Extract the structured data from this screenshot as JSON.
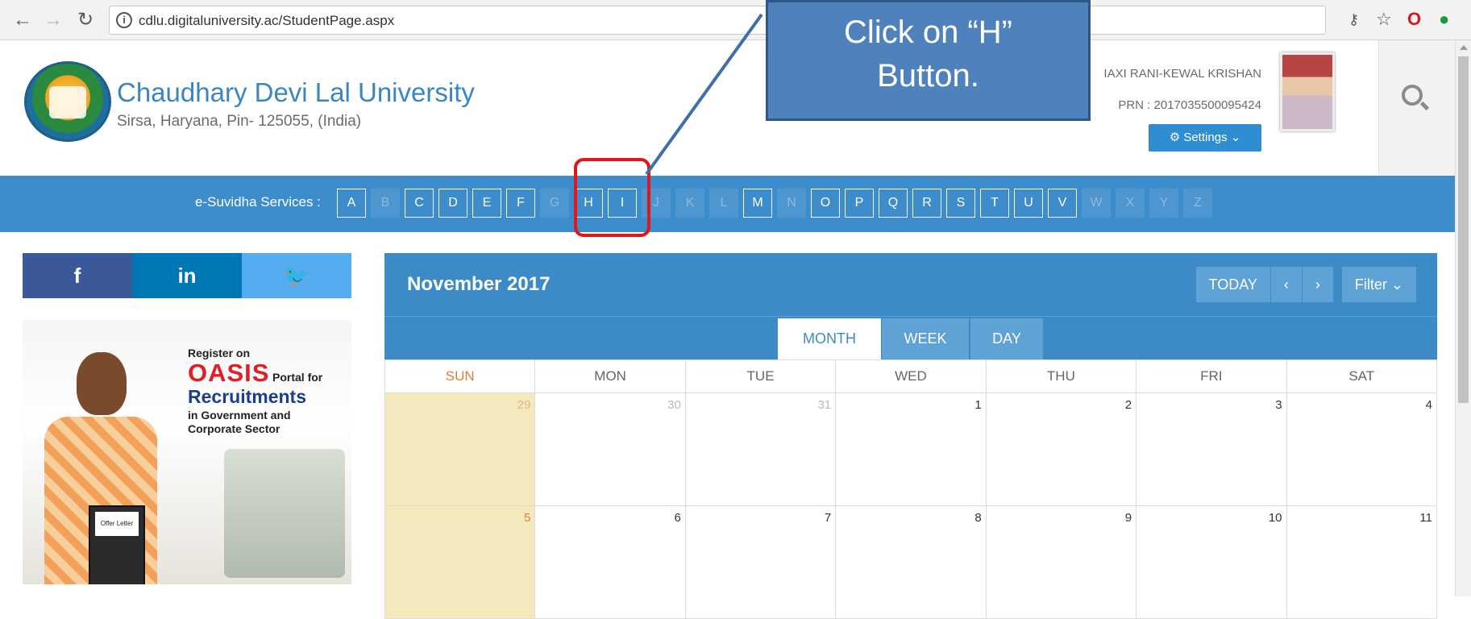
{
  "browser": {
    "url": "cdlu.digitaluniversity.ac/StudentPage.aspx",
    "back_icon": "arrow-left-icon",
    "forward_icon": "arrow-right-icon",
    "reload_icon": "reload-icon",
    "info_icon": "info-icon"
  },
  "header": {
    "university_name": "Chaudhary Devi Lal University",
    "address": "Sirsa, Haryana, Pin- 125055, (India)",
    "user_name": "IAXI RANI-KEWAL KRISHAN",
    "prn": "PRN : 2017035500095424",
    "settings_label": "⚙ Settings ⌄"
  },
  "callout": {
    "line1": "Click on “H”",
    "line2": "Button."
  },
  "services": {
    "label": "e-Suvidha Services :",
    "letters": [
      {
        "l": "A",
        "on": true
      },
      {
        "l": "B",
        "on": false
      },
      {
        "l": "C",
        "on": true
      },
      {
        "l": "D",
        "on": true
      },
      {
        "l": "E",
        "on": true
      },
      {
        "l": "F",
        "on": true
      },
      {
        "l": "G",
        "on": false
      },
      {
        "l": "H",
        "on": true
      },
      {
        "l": "I",
        "on": true
      },
      {
        "l": "J",
        "on": false
      },
      {
        "l": "K",
        "on": false
      },
      {
        "l": "L",
        "on": false
      },
      {
        "l": "M",
        "on": true
      },
      {
        "l": "N",
        "on": false
      },
      {
        "l": "O",
        "on": true
      },
      {
        "l": "P",
        "on": true
      },
      {
        "l": "Q",
        "on": true
      },
      {
        "l": "R",
        "on": true
      },
      {
        "l": "S",
        "on": true
      },
      {
        "l": "T",
        "on": true
      },
      {
        "l": "U",
        "on": true
      },
      {
        "l": "V",
        "on": true
      },
      {
        "l": "W",
        "on": false
      },
      {
        "l": "X",
        "on": false
      },
      {
        "l": "Y",
        "on": false
      },
      {
        "l": "Z",
        "on": false
      }
    ]
  },
  "social": {
    "facebook": "f",
    "linkedin": "in",
    "twitter": "🐦"
  },
  "ad": {
    "register": "Register on",
    "oasis": "OASIS",
    "portal_for": "Portal for",
    "recruitments": "Recruitments",
    "sub": "in Government and Corporate Sector",
    "offer_letter": "Offer Letter"
  },
  "calendar": {
    "title": "November 2017",
    "today_label": "TODAY",
    "prev_label": "‹",
    "next_label": "›",
    "filter_label": "Filter ⌄",
    "views": {
      "month": "MONTH",
      "week": "WEEK",
      "day": "DAY"
    },
    "days_of_week": [
      "SUN",
      "MON",
      "TUE",
      "WED",
      "THU",
      "FRI",
      "SAT"
    ],
    "weeks": [
      [
        {
          "n": "29",
          "other": true
        },
        {
          "n": "30",
          "other": true
        },
        {
          "n": "31",
          "other": true
        },
        {
          "n": "1"
        },
        {
          "n": "2"
        },
        {
          "n": "3"
        },
        {
          "n": "4"
        }
      ],
      [
        {
          "n": "5"
        },
        {
          "n": "6"
        },
        {
          "n": "7"
        },
        {
          "n": "8"
        },
        {
          "n": "9"
        },
        {
          "n": "10"
        },
        {
          "n": "11"
        }
      ]
    ]
  }
}
